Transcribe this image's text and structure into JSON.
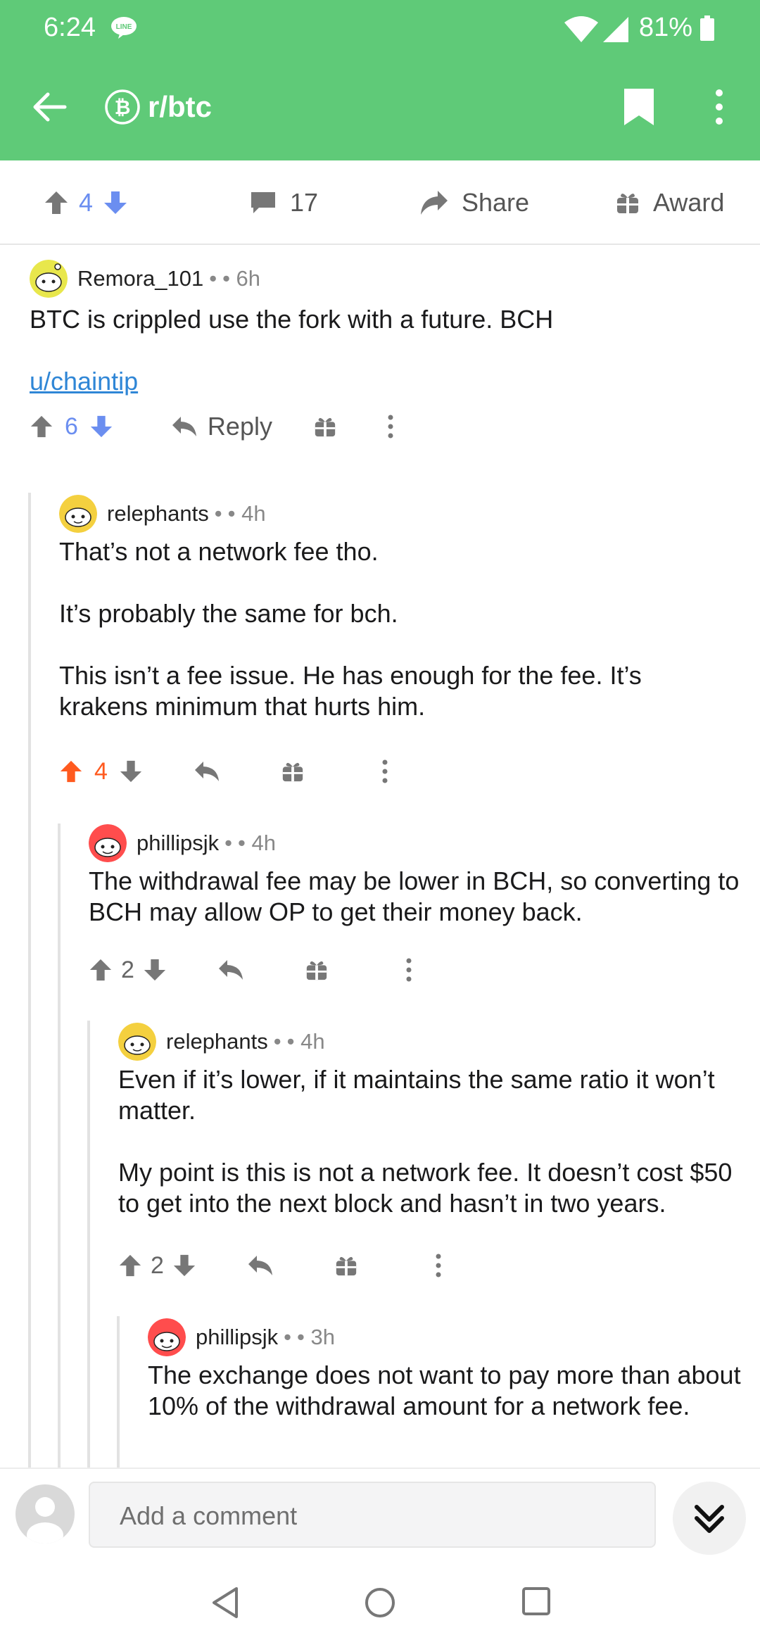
{
  "status": {
    "time": "6:24",
    "battery_text": "81%"
  },
  "appbar": {
    "subreddit": "r/btc"
  },
  "postbar": {
    "vote_count": "4",
    "comment_count": "17",
    "share_label": "Share",
    "award_label": "Award"
  },
  "comments": [
    {
      "user": "Remora_101",
      "dot": "•",
      "age": "• 6h",
      "paragraphs": [
        "BTC is crippled use the fork with a future. BCH"
      ],
      "link": "u/chaintip",
      "votes": "6",
      "reply_label": "Reply"
    },
    {
      "user": "relephants",
      "dot": "•",
      "age": "• 4h",
      "paragraphs": [
        "That’s not a network fee tho.",
        "It’s probably the same for bch.",
        "This isn’t a fee issue. He has enough for the fee. It’s krakens minimum that hurts him."
      ],
      "votes": "4"
    },
    {
      "user": "phillipsjk",
      "dot": "•",
      "age": "• 4h",
      "paragraphs": [
        "The withdrawal fee may be lower in BCH, so converting to BCH may allow OP to get their money back."
      ],
      "votes": "2"
    },
    {
      "user": "relephants",
      "dot": "•",
      "age": "• 4h",
      "paragraphs": [
        "Even if it’s lower, if it maintains the same ratio it won’t matter.",
        "My point is this is not a network fee. It doesn’t cost $50 to get into the next block and hasn’t in two years."
      ],
      "votes": "2"
    },
    {
      "user": "phillipsjk",
      "dot": "•",
      "age": "• 3h",
      "paragraphs": [
        "The exchange does not want to pay more than about 10% of the withdrawal amount for a network fee."
      ]
    }
  ],
  "composer": {
    "placeholder": "Add a comment"
  },
  "colors": {
    "header_green": "#5fca78",
    "upvote_orange": "#ff5a1f",
    "downvote_blue": "#6b8ef0",
    "link_blue": "#2f86d6"
  }
}
